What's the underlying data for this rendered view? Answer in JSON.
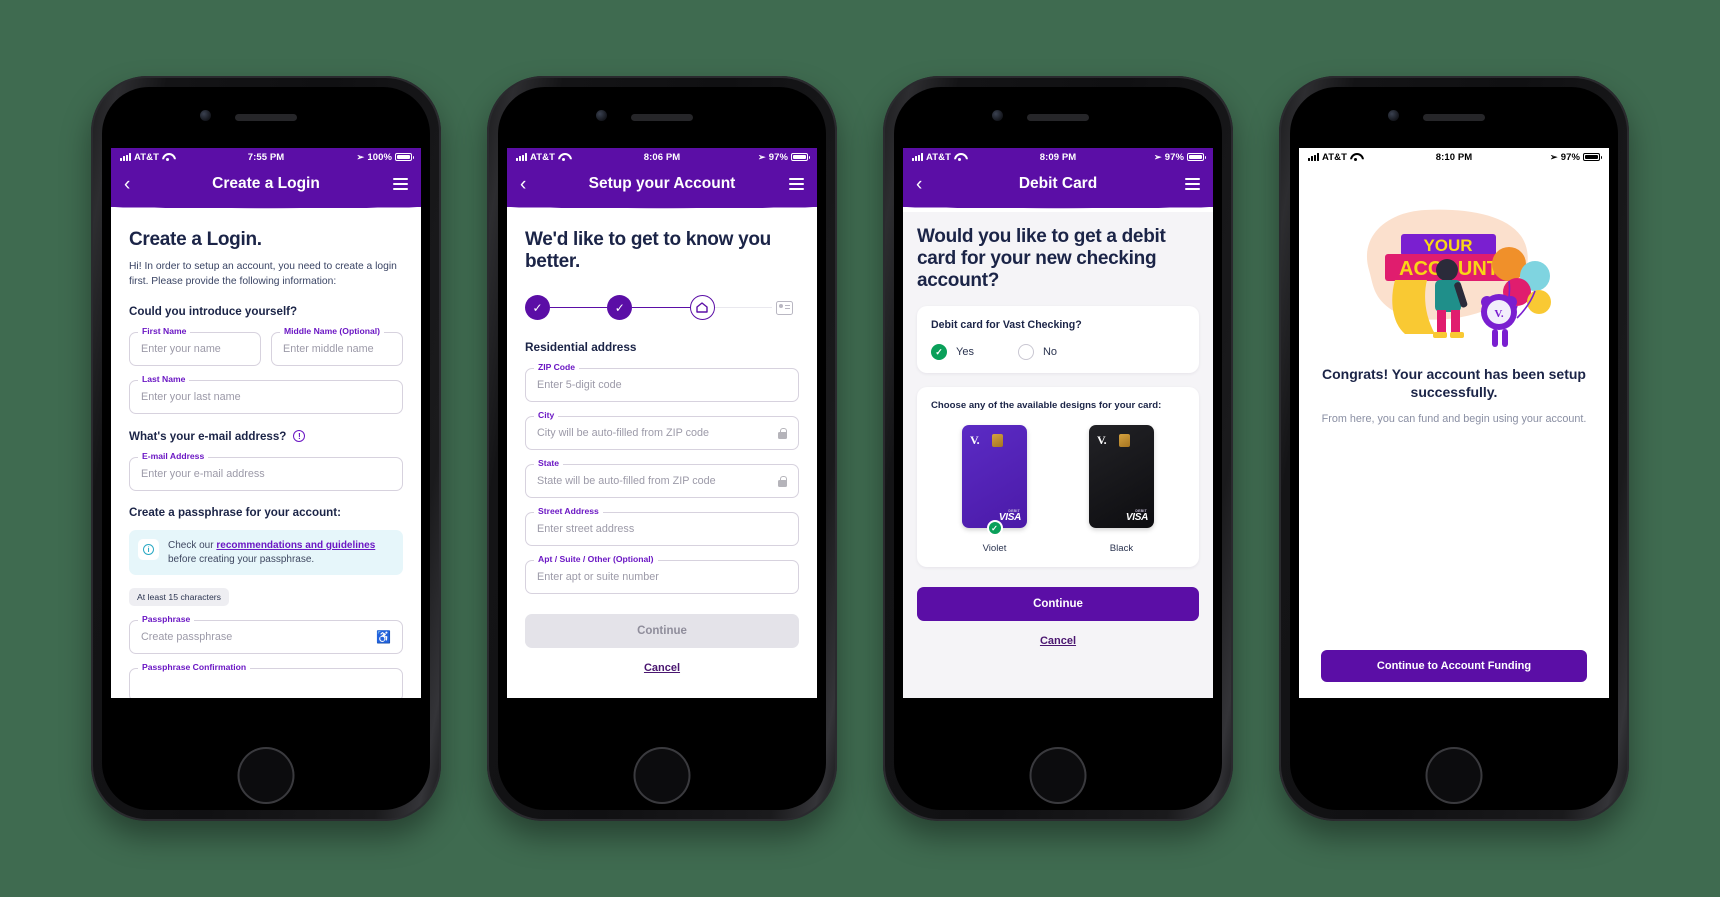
{
  "screens": [
    {
      "id": "create-login",
      "status": {
        "carrier": "AT&T",
        "time": "7:55 PM",
        "battery": "100%"
      },
      "nav": {
        "title": "Create a Login",
        "back": "‹"
      },
      "heading": "Create a Login.",
      "intro": "Hi! In order to setup an account, you need to create a login first. Please provide the following information:",
      "section_name": "Could you introduce yourself?",
      "fields": {
        "first_name": {
          "label": "First Name",
          "placeholder": "Enter your name"
        },
        "middle_name": {
          "label": "Middle Name (Optional)",
          "placeholder": "Enter middle name"
        },
        "last_name": {
          "label": "Last Name",
          "placeholder": "Enter your last name"
        },
        "email": {
          "label": "E-mail Address",
          "placeholder": "Enter your e-mail address"
        },
        "passphrase": {
          "label": "Passphrase",
          "placeholder": "Create passphrase"
        },
        "passphrase_confirm": {
          "label": "Passphrase Confirmation",
          "placeholder": ""
        }
      },
      "section_email": "What's your e-mail address?",
      "section_pass": "Create a passphrase for your account:",
      "banner": {
        "before": "Check our ",
        "link": "recommendations and guidelines",
        "after": " before creating your passphrase."
      },
      "chip": "At least 15 characters"
    },
    {
      "id": "setup-account",
      "status": {
        "carrier": "AT&T",
        "time": "8:06 PM",
        "battery": "97%"
      },
      "nav": {
        "title": "Setup your Account",
        "back": "‹"
      },
      "heading": "We'd like to get to know you better.",
      "stepper": [
        {
          "name": "step-1",
          "state": "done",
          "icon": "check-icon"
        },
        {
          "name": "step-2",
          "state": "done",
          "icon": "check-icon"
        },
        {
          "name": "step-3",
          "state": "current",
          "icon": "home-icon"
        },
        {
          "name": "step-4",
          "state": "todo",
          "icon": "id-card-icon"
        }
      ],
      "section_name": "Residential address",
      "fields": {
        "zip": {
          "label": "ZIP Code",
          "placeholder": "Enter 5-digit code"
        },
        "city": {
          "label": "City",
          "placeholder": "City will be auto-filled from ZIP code",
          "locked": true
        },
        "state": {
          "label": "State",
          "placeholder": "State will be auto-filled from ZIP code",
          "locked": true
        },
        "street": {
          "label": "Street Address",
          "placeholder": "Enter street address"
        },
        "apt": {
          "label": "Apt / Suite / Other (Optional)",
          "placeholder": "Enter apt or suite number"
        }
      },
      "continue": "Continue",
      "cancel": "Cancel"
    },
    {
      "id": "debit-card",
      "status": {
        "carrier": "AT&T",
        "time": "8:09 PM",
        "battery": "97%"
      },
      "nav": {
        "title": "Debit Card",
        "back": "‹"
      },
      "heading": "Would you like to get a debit card for your new checking account?",
      "question": "Debit card for Vast Checking?",
      "options": [
        {
          "label": "Yes",
          "selected": true
        },
        {
          "label": "No",
          "selected": false
        }
      ],
      "designs_title": "Choose any of the available designs for your card:",
      "cards": [
        {
          "name": "Violet",
          "theme": "violet",
          "selected": true,
          "logo": "V.",
          "network": "VISA",
          "tier": "DEBIT"
        },
        {
          "name": "Black",
          "theme": "black",
          "selected": false,
          "logo": "V.",
          "network": "VISA",
          "tier": "DEBIT"
        }
      ],
      "continue": "Continue",
      "cancel": "Cancel"
    },
    {
      "id": "success",
      "status": {
        "carrier": "AT&T",
        "time": "8:10 PM",
        "battery": "97%"
      },
      "illustration": {
        "word_top": "YOUR",
        "word_bottom": "ACCOUNT"
      },
      "heading": "Congrats! Your account has been setup successfully.",
      "body": "From here, you can fund and begin using your account.",
      "cta": "Continue to Account Funding"
    }
  ],
  "colors": {
    "brand_purple": "#5b0ea6",
    "label_purple": "#6b17c4",
    "navy": "#1b2447",
    "green": "#0aa05a",
    "background": "#3f6b50",
    "banner_blue": "#e6f6fa"
  }
}
